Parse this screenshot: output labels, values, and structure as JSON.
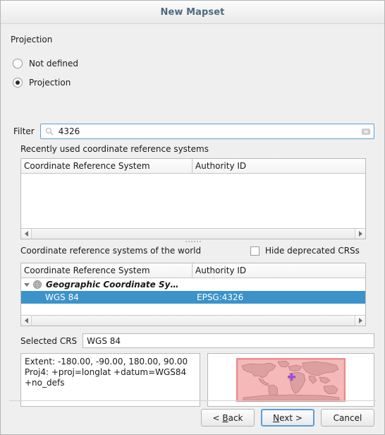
{
  "window": {
    "title": "New Mapset"
  },
  "projection": {
    "group_label": "Projection",
    "options": [
      {
        "label": "Not defined",
        "checked": false
      },
      {
        "label": "Projection",
        "checked": true
      }
    ]
  },
  "filter": {
    "label": "Filter",
    "value": "4326",
    "placeholder": "",
    "search_icon": "search-icon",
    "clear_icon": "clear-icon"
  },
  "recent": {
    "label": "Recently used coordinate reference systems",
    "columns": [
      "Coordinate Reference System",
      "Authority ID"
    ],
    "rows": []
  },
  "world": {
    "label": "Coordinate reference systems of the world",
    "hide_deprecated": {
      "label": "Hide deprecated CRSs",
      "checked": false
    },
    "columns": [
      "Coordinate Reference System",
      "Authority ID"
    ],
    "rows": [
      {
        "type": "group",
        "expanded": true,
        "icon": "globe-icon",
        "name": "Geographic Coordinate Sy…",
        "authority": "",
        "selected": false
      },
      {
        "type": "leaf",
        "name": "WGS 84",
        "authority": "EPSG:4326",
        "selected": true
      }
    ]
  },
  "selected_crs": {
    "label": "Selected CRS",
    "value": "WGS 84"
  },
  "info": {
    "text": "Extent: -180.00, -90.00, 180.00, 90.00\nProj4: +proj=longlat +datum=WGS84 +no_defs"
  },
  "preview": {
    "name": "world-map-preview",
    "fill": "#f5b9b9",
    "border": "#e88a8a",
    "coastline": "#b06b6b",
    "marker": "#9d4edd"
  },
  "footer": {
    "buttons": [
      {
        "name": "back-button",
        "prefix": "< ",
        "accel": "B",
        "suffix": "ack",
        "default": false
      },
      {
        "name": "next-button",
        "prefix": "",
        "accel": "N",
        "suffix": "ext >",
        "default": true
      },
      {
        "name": "cancel-button",
        "prefix": "",
        "accel": "",
        "suffix": "Cancel",
        "default": false
      }
    ]
  },
  "colors": {
    "selection": "#3b93c9",
    "focus_border": "#5a9fd4",
    "dialog_bg": "#efefef",
    "title_text": "#4d6a80"
  }
}
